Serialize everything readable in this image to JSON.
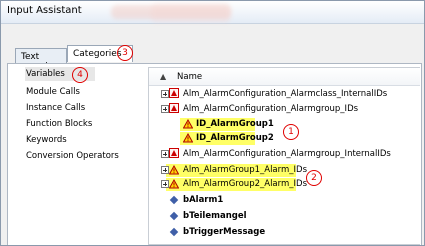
{
  "window": {
    "title": "Input Assistant"
  },
  "tabs": [
    {
      "label": "Text search"
    },
    {
      "label": "Categories"
    }
  ],
  "badges": [
    "1",
    "2",
    "3",
    "4"
  ],
  "left_items": [
    {
      "label": "Variables"
    },
    {
      "label": "Module Calls"
    },
    {
      "label": "Instance Calls"
    },
    {
      "label": "Function Blocks"
    },
    {
      "label": "Keywords"
    },
    {
      "label": "Conversion Operators"
    }
  ],
  "tree": {
    "header": "Name",
    "rows": [
      {
        "label": "Alm_AlarmConfiguration_Alarmclass_InternalIDs"
      },
      {
        "label": "Alm_AlarmConfiguration_Alarmgroup_IDs"
      },
      {
        "label": "ID_AlarmGroup1"
      },
      {
        "label": "ID_AlarmGroup2"
      },
      {
        "label": "Alm_AlarmConfiguration_Alarmgroup_InternalIDs"
      },
      {
        "label": "Alm_AlarmGroup1_Alarm_IDs"
      },
      {
        "label": "Alm_AlarmGroup2_Alarm_IDs"
      },
      {
        "label": "bAlarm1"
      },
      {
        "label": "bTeilemangel"
      },
      {
        "label": "bTriggerMessage"
      }
    ]
  }
}
